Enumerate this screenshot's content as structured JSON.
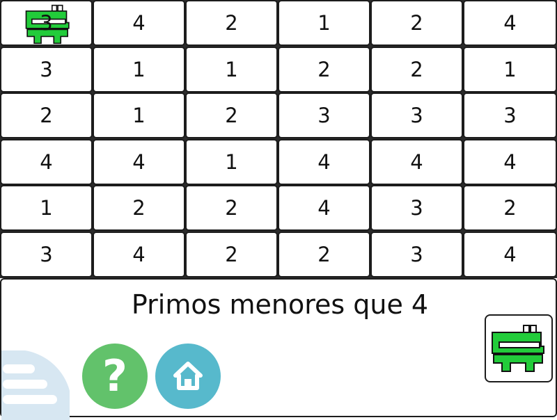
{
  "board": {
    "rows": [
      [
        "3",
        "4",
        "2",
        "1",
        "2",
        "4"
      ],
      [
        "3",
        "1",
        "1",
        "2",
        "2",
        "1"
      ],
      [
        "2",
        "1",
        "2",
        "3",
        "3",
        "3"
      ],
      [
        "4",
        "4",
        "1",
        "4",
        "4",
        "4"
      ],
      [
        "1",
        "2",
        "2",
        "4",
        "3",
        "2"
      ],
      [
        "3",
        "4",
        "2",
        "2",
        "3",
        "4"
      ]
    ],
    "muncher_row": 0,
    "muncher_col": 0
  },
  "goal": {
    "text": "Primos menores que 4"
  },
  "buttons": {
    "help_icon": "question-mark-icon",
    "home_icon": "home-icon",
    "menu_icon": "menu-bars-icon"
  },
  "colors": {
    "muncher_green": "#22cc3a",
    "help": "#62c26b",
    "home": "#57b9cc",
    "menu": "#d7e7f2"
  }
}
